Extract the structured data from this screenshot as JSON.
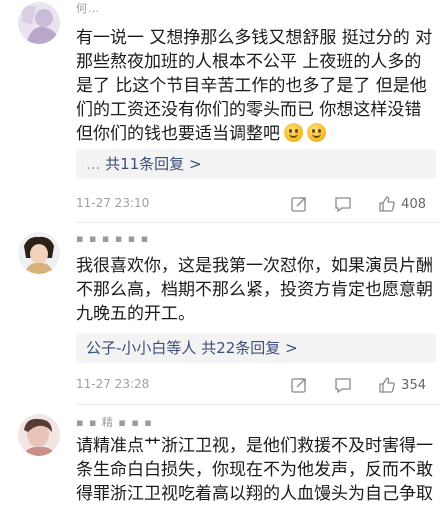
{
  "comments": [
    {
      "username": "何…",
      "text": "有一说一 又想挣那么多钱又想舒服 挺过分的 对那些熬夜加班的人根本不公平 上夜班的人多的是了 比这个节目辛苦工作的也多了是了 但是他们的工资还没有你们的零头而已 你想这样没错但你们的钱也要适当调整吧",
      "emoji_count": 2,
      "reply_prefix": "...",
      "reply_summary": "共11条回复",
      "time": "11-27 23:10",
      "likes": "408"
    },
    {
      "username": "▪ ▪ ▪ ▪ ▪ ▪",
      "text": "我很喜欢你，这是我第一次怼你，如果演员片酬不那么高，档期不那么紧，投资方肯定也愿意朝九晚五的开工。",
      "reply_prefix": "公子-小小白等人",
      "reply_summary": "共22条回复",
      "time": "11-27 23:28",
      "likes": "354"
    },
    {
      "username": "▪ ▪ 精 ▪ ▪ ▪",
      "text": "请精准点艹浙江卫视，是他们救援不及时害得一条生命白白损失，你现在不为他发声，反而不敢得罪浙江卫视吃着高以翔的人血馒头为自己争取"
    }
  ],
  "icons": {
    "share": "share-icon",
    "comment": "comment-icon",
    "like": "thumbs-up-icon"
  },
  "reply_arrow": ">"
}
